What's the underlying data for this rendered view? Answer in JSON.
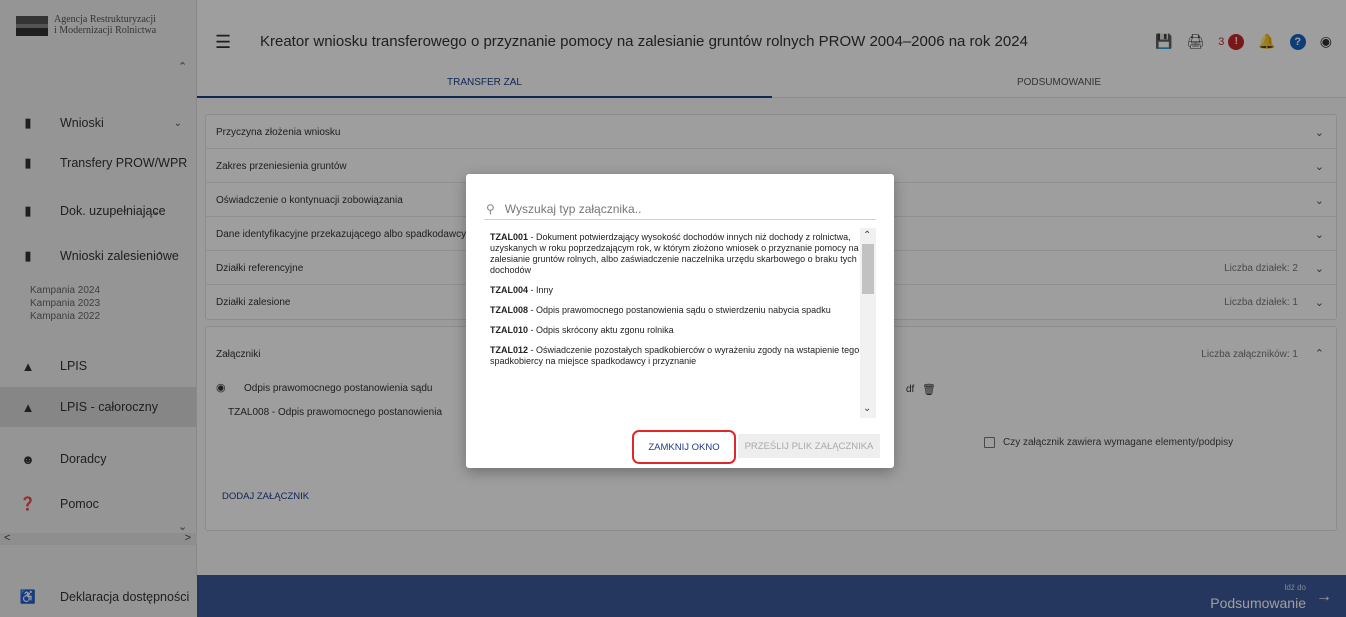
{
  "sidebar": {
    "logo_text_line1": "Agencja Restrukturyzacji",
    "logo_text_line2": "i Modernizacji Rolnictwa",
    "items": [
      {
        "label": "Wnioski",
        "icon": "clipboard-icon"
      },
      {
        "label": "Transfery PROW/WPR",
        "icon": "clipboard-icon"
      },
      {
        "label": "Dok. uzupełniające",
        "icon": "clipboard-icon"
      },
      {
        "label": "Wnioski zalesieniowe",
        "icon": "clipboard-icon"
      },
      {
        "label": "LPIS",
        "icon": "mountain-icon"
      },
      {
        "label": "LPIS - całoroczny",
        "icon": "mountain-icon"
      },
      {
        "label": "Doradcy",
        "icon": "person-icon"
      },
      {
        "label": "Pomoc",
        "icon": "help-circle-icon"
      }
    ],
    "subitems": [
      "Kampania 2024",
      "Kampania 2023",
      "Kampania 2022"
    ],
    "bottom_label": "Deklaracja dostępności"
  },
  "header": {
    "title": "Kreator wniosku transferowego o przyznanie pomocy na zalesianie gruntów rolnych PROW 2004–2006 na rok 2024",
    "alert_count": "3"
  },
  "tabs": [
    "TRANSFER ZAL",
    "PODSUMOWANIE"
  ],
  "panels": [
    {
      "title": "Przyczyna złożenia wniosku",
      "meta": ""
    },
    {
      "title": "Zakres przeniesienia gruntów",
      "meta": ""
    },
    {
      "title": "Oświadczenie o kontynuacji zobowiązania",
      "meta": ""
    },
    {
      "title": "Dane identyfikacyjne przekazującego albo spadkodawcy",
      "meta": ""
    },
    {
      "title": "Działki referencyjne",
      "meta": "Liczba działek: 2"
    },
    {
      "title": "Działki zalesione",
      "meta": "Liczba działek: 1"
    }
  ],
  "attachments": {
    "title": "Załączniki",
    "meta": "Liczba załączników: 1",
    "file_name": "Odpis prawomocnego postanowienia sądu",
    "file_ext": "df",
    "type_label": "TZAL008 - Odpis prawomocnego postanowienia",
    "checkbox_label": "Czy załącznik zawiera wymagane elementy/podpisy",
    "add_label": "DODAJ ZAŁĄCZNIK"
  },
  "footer": {
    "small": "Idź do",
    "big": "Podsumowanie"
  },
  "modal": {
    "search_placeholder": "Wyszukaj typ załącznika..",
    "items": [
      {
        "code": "TZAL001",
        "text": " - Dokument potwierdzający wysokość dochodów innych niż dochody z rolnictwa, uzyskanych w roku poprzedzającym rok, w którym złożono wniosek o przyznanie pomocy na zalesianie gruntów rolnych, albo zaświadczenie naczelnika urzędu skarbowego o braku tych dochodów"
      },
      {
        "code": "TZAL004",
        "text": " - Inny"
      },
      {
        "code": "TZAL008",
        "text": " - Odpis prawomocnego postanowienia sądu o stwierdzeniu nabycia spadku"
      },
      {
        "code": "TZAL010",
        "text": " - Odpis skrócony aktu zgonu rolnika"
      },
      {
        "code": "TZAL012",
        "text": " - Oświadczenie pozostałych spadkobierców o wyrażeniu zgody na wstapienie tego spadkobiercy na miejsce spadkodawcy i przyznanie"
      }
    ],
    "close_label": "ZAMKNIJ OKNO",
    "upload_label": "PRZEŚLIJ PLIK ZAŁĄCZNIKA"
  }
}
